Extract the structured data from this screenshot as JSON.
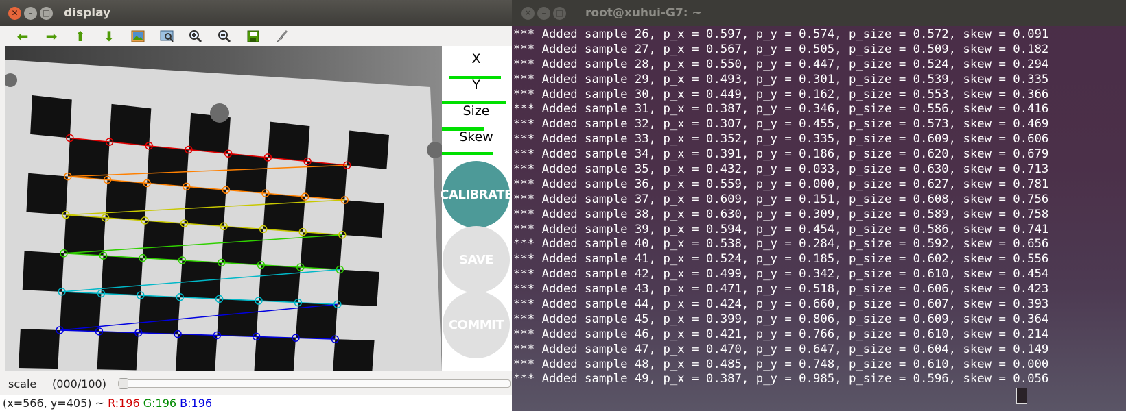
{
  "display_window": {
    "title": "display",
    "toolbar": [
      "arrow-left-icon",
      "arrow-right-icon",
      "arrow-up-icon",
      "arrow-down-icon",
      "image-icon",
      "fit-image-icon",
      "zoom-in-icon",
      "zoom-out-icon",
      "save-icon",
      "brush-icon"
    ],
    "metrics": {
      "x_label": "X",
      "y_label": "Y",
      "size_label": "Size",
      "skew_label": "Skew",
      "x_level": 0.78,
      "y_level": 0.95,
      "size_level": 0.62,
      "skew_level": 0.76
    },
    "buttons": {
      "calibrate": "CALIBRATE",
      "save": "SAVE",
      "commit": "COMMIT"
    },
    "scale": {
      "label": "scale",
      "count": "(000/100)",
      "level": 0
    },
    "status": {
      "coords": "(x=566, y=405) ~ ",
      "r": "R:196",
      "g": "G:196",
      "b": "B:196"
    },
    "colors": {
      "calibrate": "#4d9a98",
      "disabled": "#e0e0e0",
      "progress": "#00e000"
    }
  },
  "terminal_window": {
    "title": "root@xuhui-G7: ~",
    "lines": [
      "*** Added sample 26, p_x = 0.597, p_y = 0.574, p_size = 0.572, skew = 0.091",
      "*** Added sample 27, p_x = 0.567, p_y = 0.505, p_size = 0.509, skew = 0.182",
      "*** Added sample 28, p_x = 0.550, p_y = 0.447, p_size = 0.524, skew = 0.294",
      "*** Added sample 29, p_x = 0.493, p_y = 0.301, p_size = 0.539, skew = 0.335",
      "*** Added sample 30, p_x = 0.449, p_y = 0.162, p_size = 0.553, skew = 0.366",
      "*** Added sample 31, p_x = 0.387, p_y = 0.346, p_size = 0.556, skew = 0.416",
      "*** Added sample 32, p_x = 0.307, p_y = 0.455, p_size = 0.573, skew = 0.469",
      "*** Added sample 33, p_x = 0.352, p_y = 0.335, p_size = 0.609, skew = 0.606",
      "*** Added sample 34, p_x = 0.391, p_y = 0.186, p_size = 0.620, skew = 0.679",
      "*** Added sample 35, p_x = 0.432, p_y = 0.033, p_size = 0.630, skew = 0.713",
      "*** Added sample 36, p_x = 0.559, p_y = 0.000, p_size = 0.627, skew = 0.781",
      "*** Added sample 37, p_x = 0.609, p_y = 0.151, p_size = 0.608, skew = 0.756",
      "*** Added sample 38, p_x = 0.630, p_y = 0.309, p_size = 0.589, skew = 0.758",
      "*** Added sample 39, p_x = 0.594, p_y = 0.454, p_size = 0.586, skew = 0.741",
      "*** Added sample 40, p_x = 0.538, p_y = 0.284, p_size = 0.592, skew = 0.656",
      "*** Added sample 41, p_x = 0.524, p_y = 0.185, p_size = 0.602, skew = 0.556",
      "*** Added sample 42, p_x = 0.499, p_y = 0.342, p_size = 0.610, skew = 0.454",
      "*** Added sample 43, p_x = 0.471, p_y = 0.518, p_size = 0.606, skew = 0.423",
      "*** Added sample 44, p_x = 0.424, p_y = 0.660, p_size = 0.607, skew = 0.393",
      "*** Added sample 45, p_x = 0.399, p_y = 0.806, p_size = 0.609, skew = 0.364",
      "*** Added sample 46, p_x = 0.421, p_y = 0.766, p_size = 0.610, skew = 0.214",
      "*** Added sample 47, p_x = 0.470, p_y = 0.647, p_size = 0.604, skew = 0.149",
      "*** Added sample 48, p_x = 0.485, p_y = 0.748, p_size = 0.610, skew = 0.000",
      "*** Added sample 49, p_x = 0.387, p_y = 0.985, p_size = 0.596, skew = 0.056"
    ]
  }
}
